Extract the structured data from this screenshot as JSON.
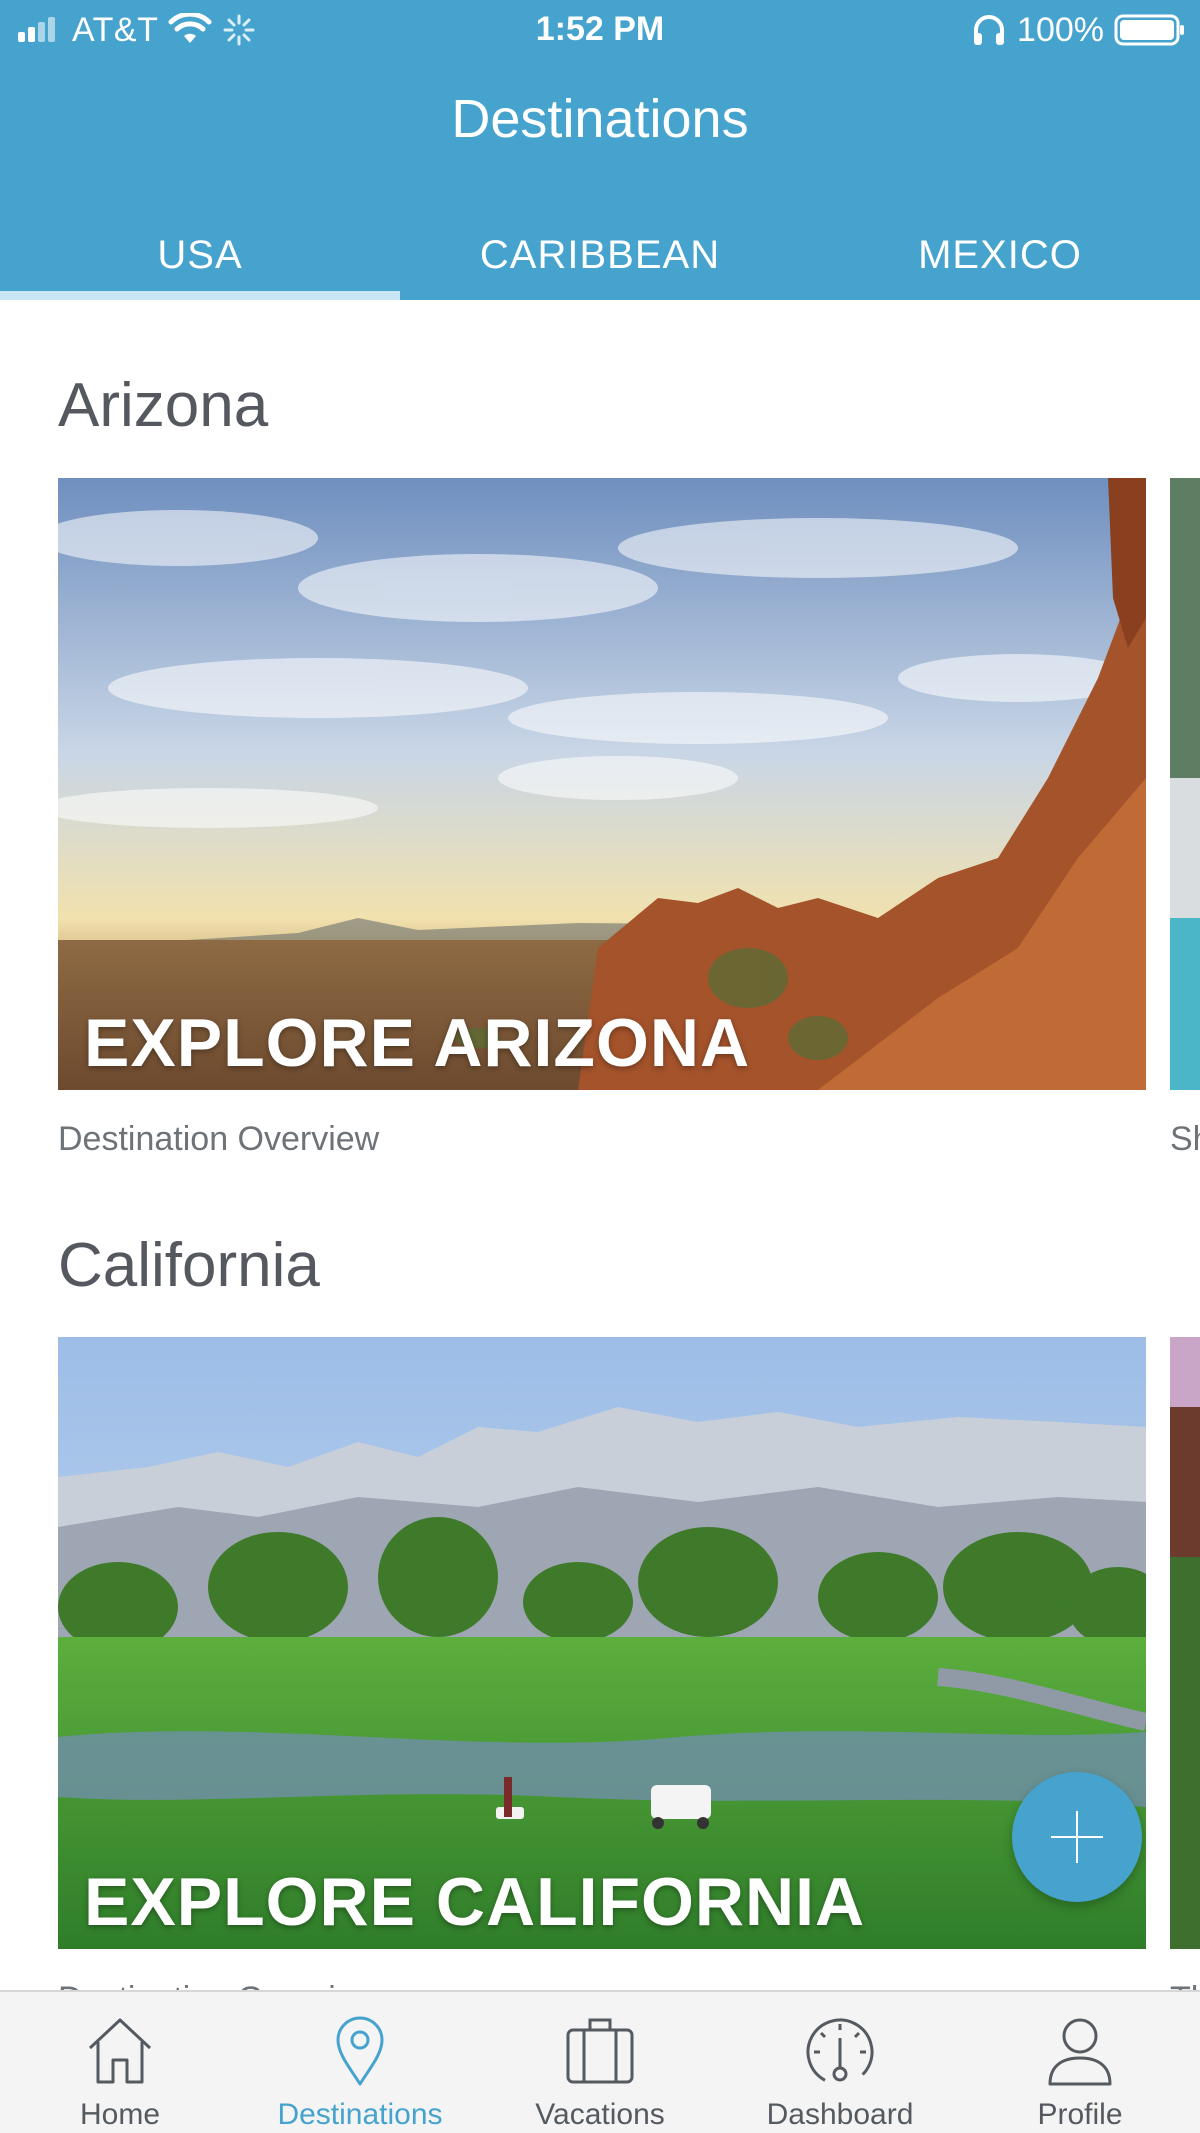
{
  "status_bar": {
    "carrier": "AT&T",
    "time": "1:52 PM",
    "battery": "100%"
  },
  "header": {
    "title": "Destinations"
  },
  "tabs": [
    {
      "label": "USA",
      "active": true
    },
    {
      "label": "CARIBBEAN",
      "active": false
    },
    {
      "label": "MEXICO",
      "active": false
    }
  ],
  "sections": [
    {
      "title": "Arizona",
      "card_label": "EXPLORE ARIZONA",
      "card_sub": "Destination Overview",
      "peek_sub": "Sh"
    },
    {
      "title": "California",
      "card_label": "EXPLORE CALIFORNIA",
      "card_sub": "Destination Overview",
      "peek_sub": "Th"
    }
  ],
  "bottom_nav": [
    {
      "label": "Home",
      "icon": "home-icon",
      "active": false
    },
    {
      "label": "Destinations",
      "icon": "location-pin-icon",
      "active": true
    },
    {
      "label": "Vacations",
      "icon": "suitcase-icon",
      "active": false
    },
    {
      "label": "Dashboard",
      "icon": "gauge-icon",
      "active": false
    },
    {
      "label": "Profile",
      "icon": "person-icon",
      "active": false
    }
  ],
  "colors": {
    "header": "#46a3cd",
    "active_tab_indicator": "#c8e6f3",
    "nav_active": "#46a3cd",
    "nav_inactive": "#555a60"
  }
}
